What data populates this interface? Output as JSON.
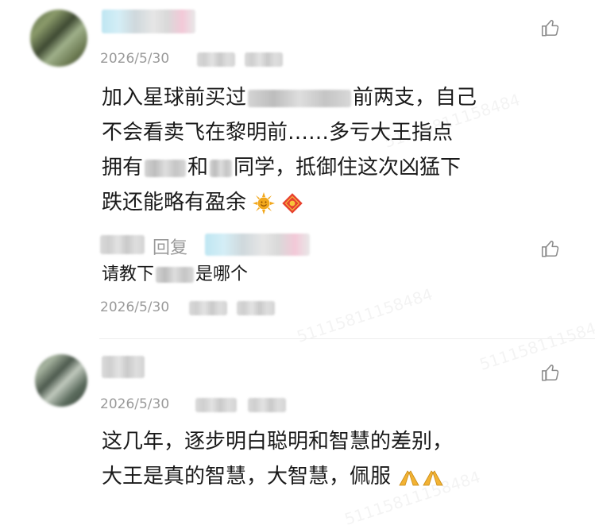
{
  "watermark": "51115811158484",
  "comments": [
    {
      "date": "2026/5/30",
      "line1_a": "加入星球前买过",
      "line1_b": "前两支，自己",
      "line2": "不会看卖飞在黎明前……多亏大王指点",
      "line3_a": "拥有",
      "line3_b": "和",
      "line3_c": "同学，抵御住这次凶猛下",
      "line4": "跌还能略有盈余",
      "reply": {
        "reply_label": "回复",
        "text_a": "请教下",
        "text_b": "是哪个",
        "date": "2026/5/30"
      }
    },
    {
      "date": "2026/5/30",
      "line1": "这几年，逐步明白聪明和智慧的差别，",
      "line2": "大王是真的智慧，大智慧，佩服"
    }
  ],
  "icons": {
    "like": "thumbs-up-icon",
    "sun": "sun-emoji-icon",
    "fortune": "fu-envelope-icon",
    "pray": "pray-hands-icon"
  },
  "colors": {
    "text": "#1a1a1a",
    "meta": "#9a9a9a",
    "icon": "#8a8a8a"
  }
}
